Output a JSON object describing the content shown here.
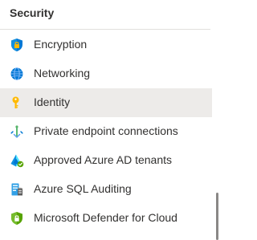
{
  "section": {
    "title": "Security"
  },
  "items": [
    {
      "label": "Encryption",
      "icon": "shield-lock-icon",
      "selected": false
    },
    {
      "label": "Networking",
      "icon": "globe-icon",
      "selected": false
    },
    {
      "label": "Identity",
      "icon": "key-icon",
      "selected": true
    },
    {
      "label": "Private endpoint connections",
      "icon": "private-endpoint-icon",
      "selected": false
    },
    {
      "label": "Approved Azure AD tenants",
      "icon": "azure-ad-icon",
      "selected": false
    },
    {
      "label": "Azure SQL Auditing",
      "icon": "sql-auditing-icon",
      "selected": false
    },
    {
      "label": "Microsoft Defender for Cloud",
      "icon": "defender-shield-icon",
      "selected": false
    }
  ],
  "colors": {
    "selected_background": "#edebe9",
    "text": "#323130",
    "divider": "#e1dfdd",
    "scroll_thumb": "#8a8886"
  }
}
